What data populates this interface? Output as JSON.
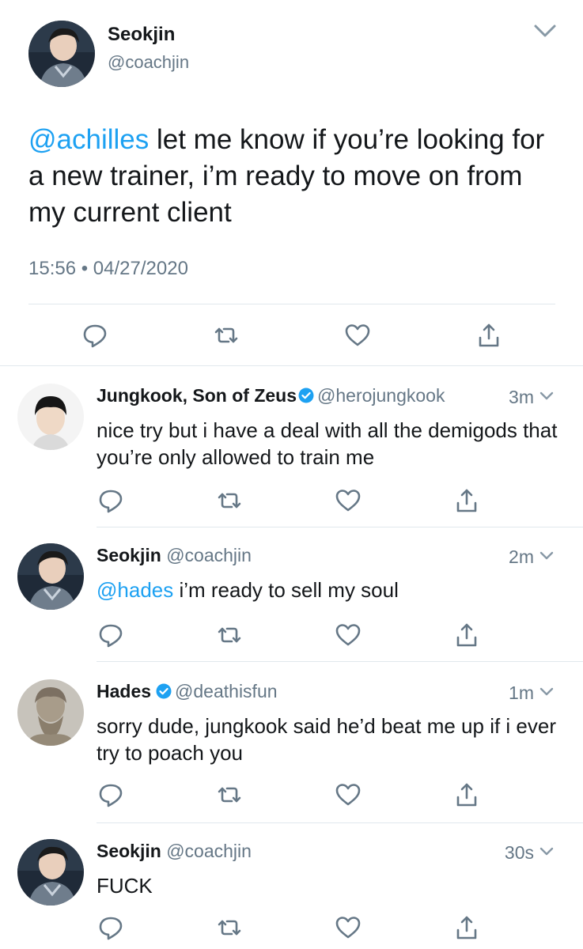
{
  "main_tweet": {
    "author_name": "Seokjin",
    "author_handle": "@coachjin",
    "mention": "@achilles",
    "text": " let me know if you’re looking for a new trainer, i’m ready to move on from my current client",
    "timestamp": "15:56 • 04/27/2020"
  },
  "replies": [
    {
      "name": "Jungkook, Son of Zeus",
      "verified": true,
      "handle": "@herojungkook",
      "time": "3m",
      "mention": "",
      "text": "nice try but i have a deal with all the demigods that you’re only allowed to train me"
    },
    {
      "name": "Seokjin",
      "verified": false,
      "handle": "@coachjin",
      "time": "2m",
      "mention": "@hades",
      "text": " i’m ready to sell my soul"
    },
    {
      "name": "Hades",
      "verified": true,
      "handle": "@deathisfun",
      "time": "1m",
      "mention": "",
      "text": "sorry dude, jungkook said he’d beat me up if i ever try to poach you"
    },
    {
      "name": "Seokjin",
      "verified": false,
      "handle": "@coachjin",
      "time": "30s",
      "mention": "",
      "text": "FUCK"
    }
  ],
  "icons": {
    "reply": "reply-icon",
    "retweet": "retweet-icon",
    "like": "heart-icon",
    "share": "share-icon",
    "menu": "chevron-down-icon",
    "verified": "verified-badge-icon"
  },
  "colors": {
    "link": "#1da1f2",
    "secondary_text": "#657786",
    "icon": "#657786",
    "divider": "#e1e8ed"
  }
}
